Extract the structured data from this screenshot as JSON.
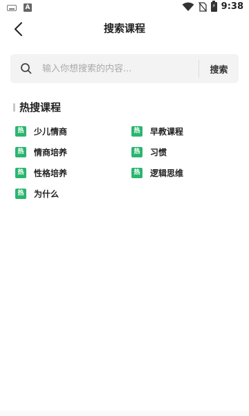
{
  "status_bar": {
    "time": "9:38",
    "left_icons": [
      "keyboard-icon",
      "a-icon"
    ],
    "a_icon_letter": "A",
    "right_icons": [
      "wifi-icon",
      "no-sim-icon",
      "battery-charging-icon"
    ]
  },
  "header": {
    "title": "搜索课程",
    "back_icon": "chevron-left-icon"
  },
  "search": {
    "placeholder": "输入你想搜索的内容...",
    "value": "",
    "button_label": "搜索",
    "icon": "search-icon"
  },
  "hot": {
    "title": "热搜课程",
    "badge": "热",
    "badge_color": "#2ab56e",
    "items": [
      {
        "label": "少儿情商"
      },
      {
        "label": "早教课程"
      },
      {
        "label": "情商培养"
      },
      {
        "label": "习惯"
      },
      {
        "label": "性格培养"
      },
      {
        "label": "逻辑思维"
      },
      {
        "label": "为什么"
      }
    ]
  }
}
